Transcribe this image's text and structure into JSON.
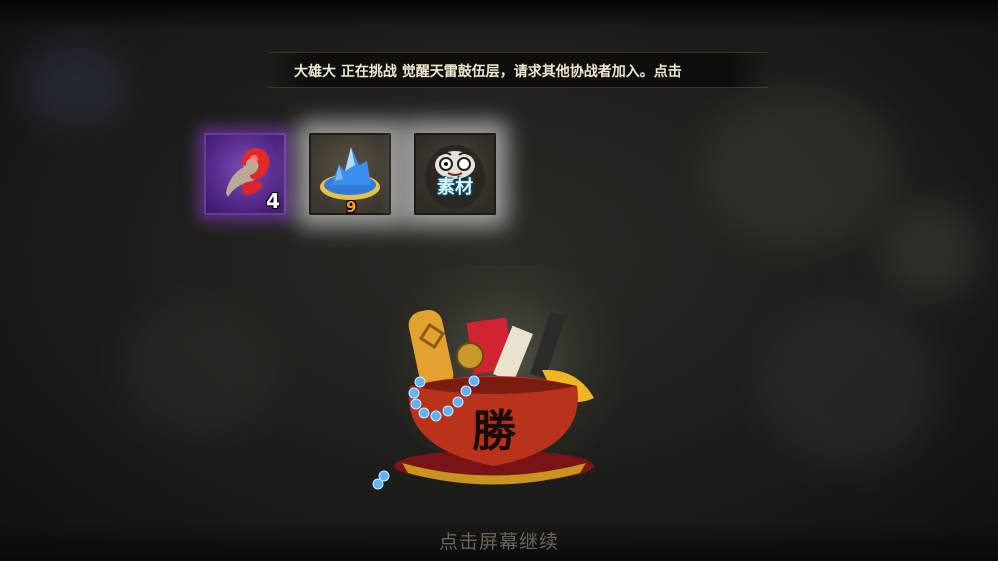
{
  "broadcast": {
    "message": "大雄大 正在挑战 觉醒天雷鼓伍层，请求其他协战者加入。点击"
  },
  "rewards": [
    {
      "icon": "red-magatama-icon",
      "count": "4",
      "frame": "purple"
    },
    {
      "icon": "blue-crystal-icon",
      "count": "9",
      "frame": "white"
    },
    {
      "icon": "daruma-icon",
      "label": "素材",
      "frame": "white"
    }
  ],
  "reward_bag": {
    "icon": "victory-bag-icon",
    "emblem": "勝"
  },
  "continue_prompt": "点击屏幕继续",
  "colors": {
    "purple_glow": "#9646dc",
    "white_glow": "#ffffff",
    "text_cream": "#efe6cf",
    "prompt_gray": "#6c6454"
  }
}
